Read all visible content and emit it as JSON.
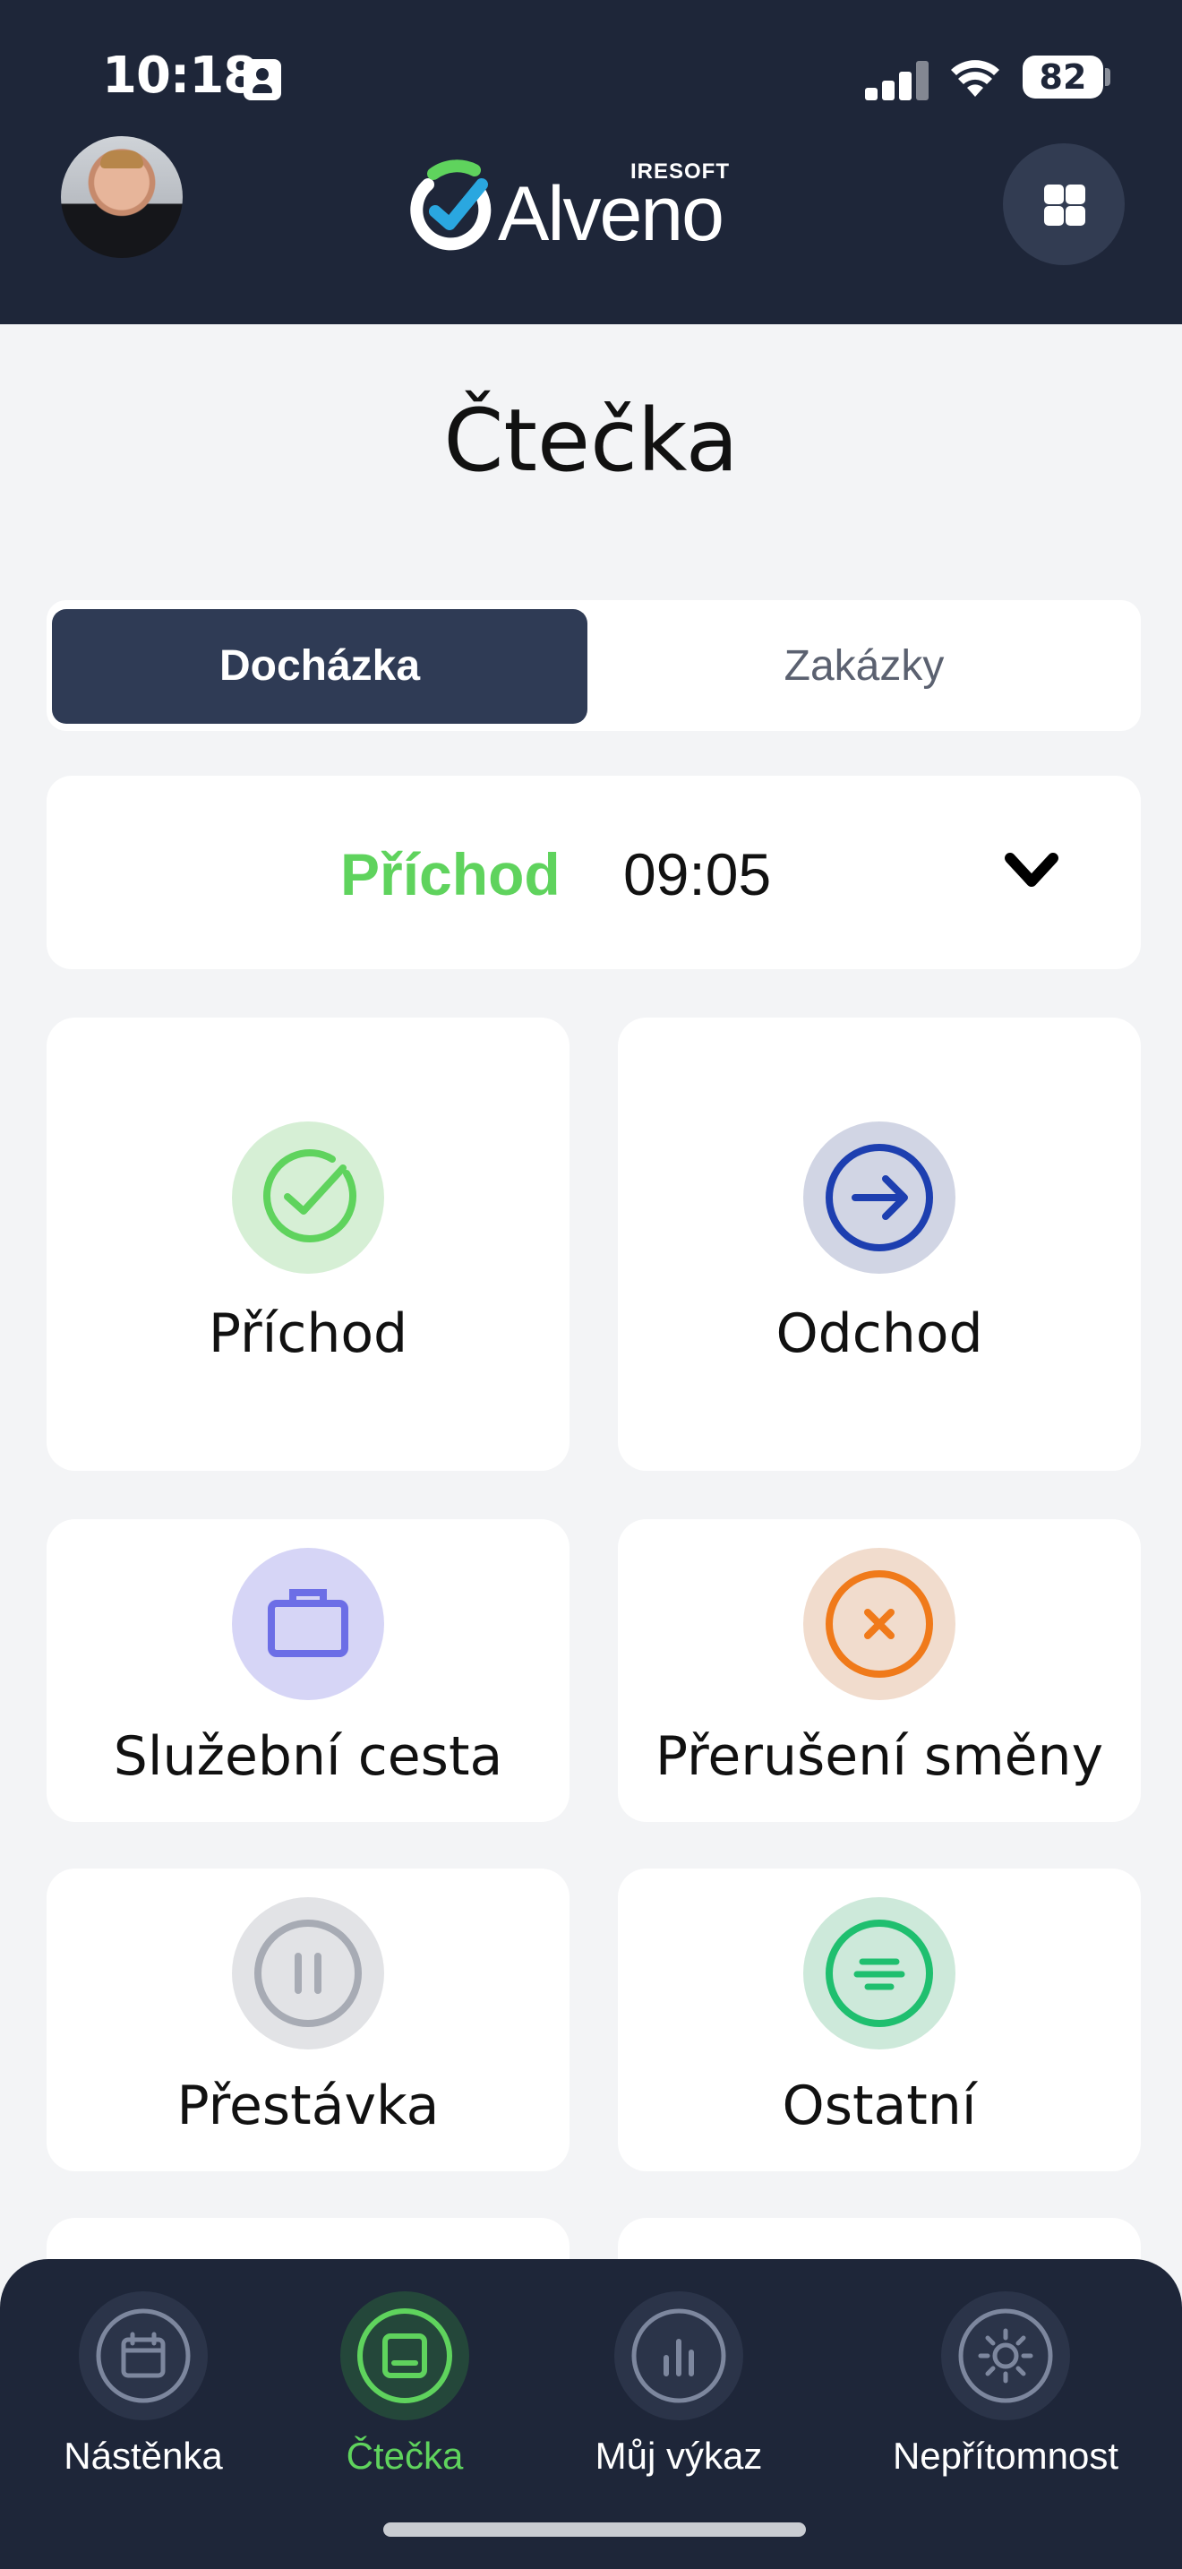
{
  "status_bar": {
    "time": "10:18",
    "battery": "82"
  },
  "header": {
    "logo_brand": "Alveno",
    "logo_company": "IRESOFT",
    "avatar": "user-avatar",
    "menu_icon": "grid-icon"
  },
  "page": {
    "title": "Čtečka"
  },
  "tabs": [
    {
      "label": "Docházka",
      "active": true
    },
    {
      "label": "Zakázky",
      "active": false
    }
  ],
  "current_status": {
    "label": "Příchod",
    "time": "09:05",
    "color": "#5fd35d"
  },
  "actions": [
    {
      "label": "Příchod",
      "icon": "check-icon",
      "color": "#5fd35d"
    },
    {
      "label": "Odchod",
      "icon": "arrow-right-icon",
      "color": "#1d3fb0"
    },
    {
      "label": "Služební cesta",
      "icon": "briefcase-icon",
      "color": "#6c6ee6"
    },
    {
      "label": "Přerušení směny",
      "icon": "close-icon",
      "color": "#f07a1a"
    },
    {
      "label": "Přestávka",
      "icon": "pause-icon",
      "color": "#a7abb4"
    },
    {
      "label": "Ostatní",
      "icon": "lines-icon",
      "color": "#1fbf6f"
    }
  ],
  "bottom_nav": [
    {
      "label": "Nástěnka",
      "icon": "calendar-icon",
      "active": false
    },
    {
      "label": "Čtečka",
      "icon": "reader-icon",
      "active": true
    },
    {
      "label": "Můj výkaz",
      "icon": "chart-icon",
      "active": false
    },
    {
      "label": "Nepřítomnost",
      "icon": "sun-icon",
      "active": false
    }
  ]
}
